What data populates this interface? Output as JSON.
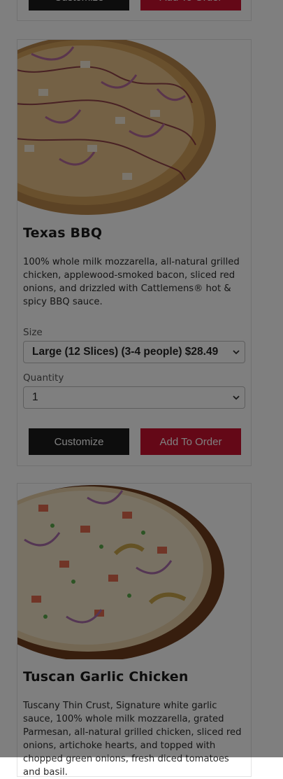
{
  "top_card": {
    "customize_label": "Customize",
    "add_label": "Add To Order"
  },
  "texas_bbq": {
    "title": "Texas BBQ",
    "description": "100% whole milk mozzarella, all-natural grilled chicken, applewood-smoked bacon, sliced red onions, and drizzled with Cattlemens® hot & spicy BBQ sauce.",
    "size_label": "Size",
    "size_value": "Large (12 Slices) (3-4 people) $28.49",
    "quantity_label": "Quantity",
    "quantity_value": "1",
    "customize_label": "Customize",
    "add_label": "Add To Order"
  },
  "tuscan": {
    "title": "Tuscan Garlic Chicken",
    "description": "Tuscany Thin Crust, Signature white garlic sauce, 100% whole milk mozzarella, grated Parmesan, all-natural grilled chicken, sliced red onions, artichoke hearts, and topped with chopped green onions, fresh diced tomatoes and basil."
  },
  "colors": {
    "button_dark": "#1a1a1a",
    "button_red": "#c8102e",
    "overlay": "rgba(0,0,0,0.5)"
  }
}
